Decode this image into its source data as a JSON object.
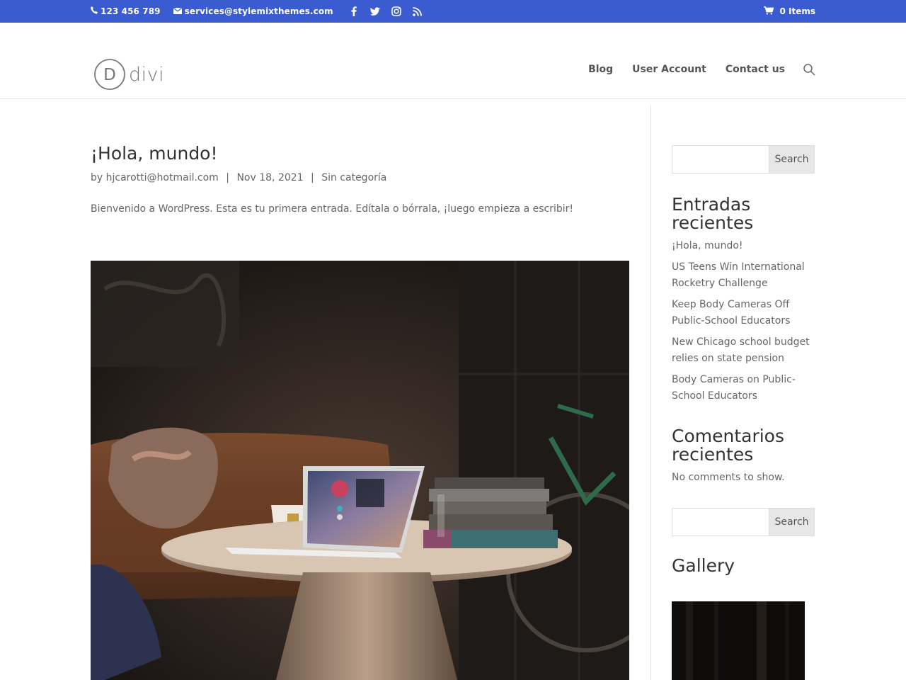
{
  "topbar": {
    "phone": "123 456 789",
    "email": "services@stylemixthemes.com",
    "social_icons": [
      "facebook-icon",
      "twitter-icon",
      "instagram-icon",
      "rss-icon"
    ],
    "cart": "0 Items",
    "bg_color": "#3b5bd1"
  },
  "header": {
    "logo_letter": "D",
    "logo_word": "divi",
    "nav": [
      "Blog",
      "User Account",
      "Contact us"
    ]
  },
  "post": {
    "title": "¡Hola, mundo!",
    "meta_by": "by",
    "author": "hjcarotti@hotmail.com",
    "date": "Nov 18, 2021",
    "category": "Sin categoría",
    "excerpt": "Bienvenido a WordPress. Esta es tu primera entrada. Edítala o bórrala, ¡luego empieza a escribir!"
  },
  "sidebar": {
    "search_label": "Search",
    "recent_posts_title": "Entradas recientes",
    "recent_posts": [
      "¡Hola, mundo!",
      "US Teens Win International Rocketry Challenge",
      "Keep Body Cameras Off Public-School Educators",
      "New Chicago school budget relies on state pension",
      "Body Cameras on Public-School Educators"
    ],
    "recent_comments_title": "Comentarios recientes",
    "no_comments": "No comments to show.",
    "search_label_2": "Search",
    "gallery_title": "Gallery"
  }
}
